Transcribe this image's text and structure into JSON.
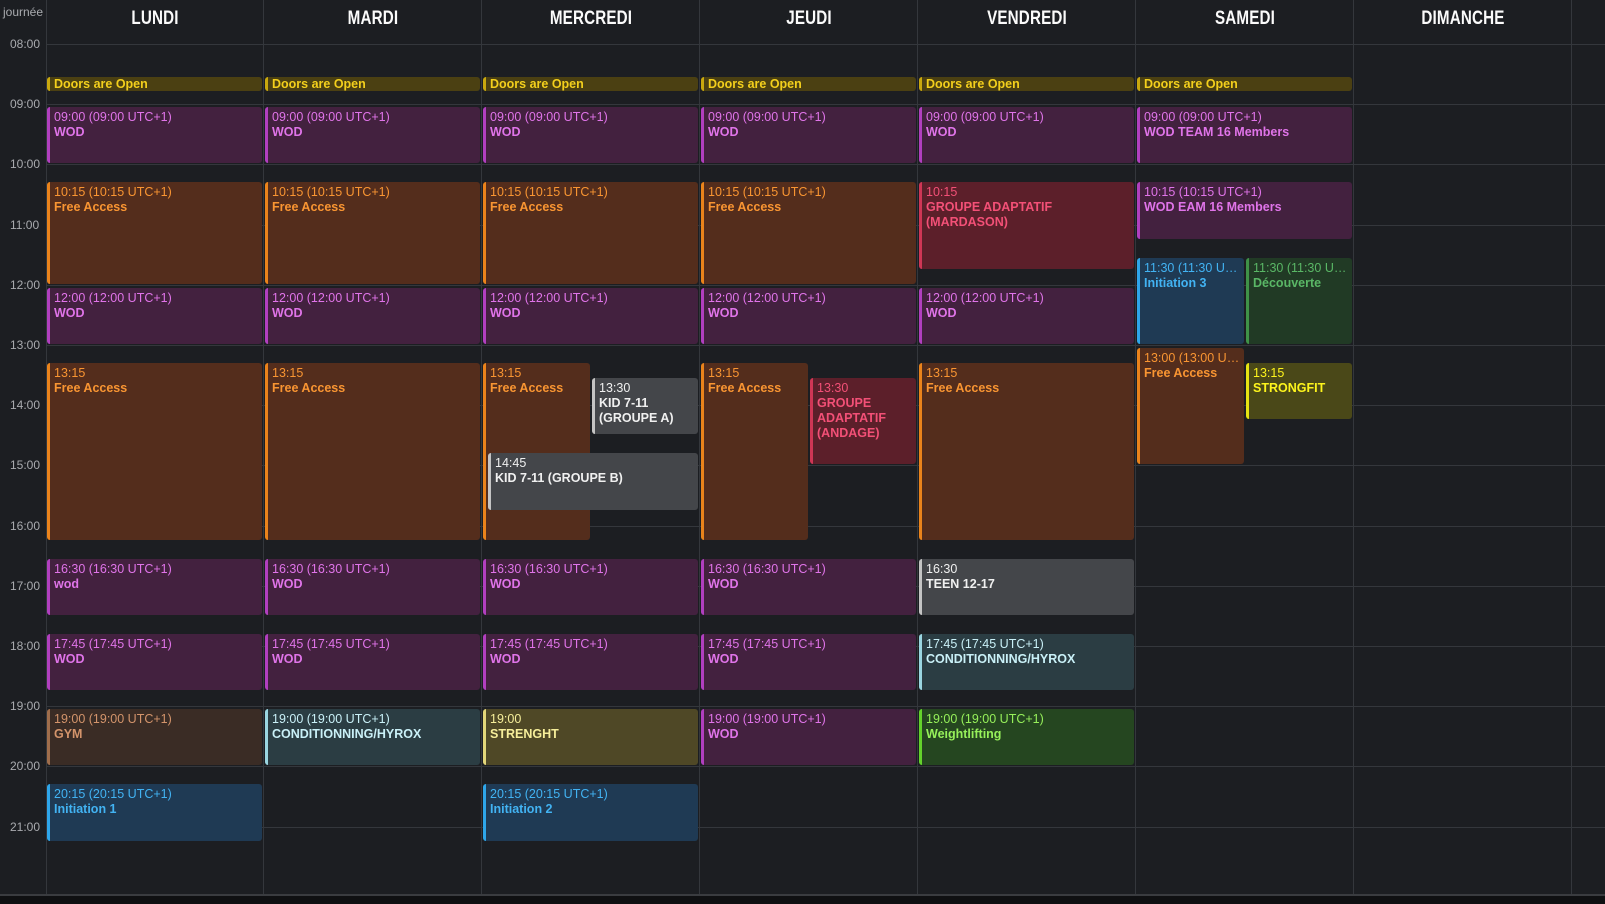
{
  "corner_label": "journée",
  "days": [
    "LUNDI",
    "MARDI",
    "MERCREDI",
    "JEUDI",
    "VENDREDI",
    "SAMEDI",
    "DIMANCHE"
  ],
  "hours": [
    "08:00",
    "09:00",
    "10:00",
    "11:00",
    "12:00",
    "13:00",
    "14:00",
    "15:00",
    "16:00",
    "17:00",
    "18:00",
    "19:00",
    "20:00",
    "21:00"
  ],
  "colors": {
    "background": "#1c1e22",
    "grid": "#34373c",
    "yellow": {
      "bg": "#4b4012",
      "bd": "#c9a80e",
      "fg": "#f3cf1c"
    },
    "purple": {
      "bg": "#43213f",
      "bd": "#b13fbf",
      "fg": "#e074e9"
    },
    "orange": {
      "bg": "#542d1c",
      "bd": "#ea831b",
      "fg": "#f99532"
    },
    "red": {
      "bg": "#5c1f2a",
      "bd": "#cf3655",
      "fg": "#f35077"
    },
    "grey": {
      "bg": "#44464a",
      "bd": "#c4c4c4",
      "fg": "#f0f0f0"
    },
    "teal": {
      "bg": "#2b3d43",
      "bd": "#9ad5e0",
      "fg": "#c9f0f7"
    },
    "brown": {
      "bg": "#3a2c25",
      "bd": "#9f6d4b",
      "fg": "#d3946b"
    },
    "olive": {
      "bg": "#4f4826",
      "bd": "#e3d679",
      "fg": "#f6ee9a"
    },
    "blue": {
      "bg": "#1f3a54",
      "bd": "#2ea6ea",
      "fg": "#42b3f3"
    },
    "green": {
      "bg": "#254620",
      "bd": "#64d22b",
      "fg": "#96f05a"
    },
    "darkgreen": {
      "bg": "#213a25",
      "bd": "#3f9248",
      "fg": "#5ab766"
    },
    "brightyellow": {
      "bg": "#4a4818",
      "bd": "#e6e313",
      "fg": "#fdf41c"
    }
  },
  "events": [
    {
      "day": 0,
      "time": "",
      "name": "Doors are Open",
      "start": 8.55,
      "end": 8.78,
      "color": "yellow",
      "banner": true
    },
    {
      "day": 0,
      "time": "09:00 (09:00 UTC+1)",
      "name": "WOD",
      "start": 9.05,
      "end": 10.0,
      "color": "purple"
    },
    {
      "day": 0,
      "time": "10:15 (10:15 UTC+1)",
      "name": "Free Access",
      "start": 10.3,
      "end": 12.0,
      "color": "orange"
    },
    {
      "day": 0,
      "time": "12:00 (12:00 UTC+1)",
      "name": "WOD",
      "start": 12.05,
      "end": 13.0,
      "color": "purple"
    },
    {
      "day": 0,
      "time": "13:15",
      "name": "Free Access",
      "start": 13.3,
      "end": 16.25,
      "color": "orange"
    },
    {
      "day": 0,
      "time": "16:30 (16:30 UTC+1)",
      "name": "wod",
      "start": 16.55,
      "end": 17.5,
      "color": "purple"
    },
    {
      "day": 0,
      "time": "17:45 (17:45 UTC+1)",
      "name": "WOD",
      "start": 17.8,
      "end": 18.75,
      "color": "purple"
    },
    {
      "day": 0,
      "time": "19:00 (19:00 UTC+1)",
      "name": "GYM",
      "start": 19.05,
      "end": 20.0,
      "color": "brown"
    },
    {
      "day": 0,
      "time": "20:15 (20:15 UTC+1)",
      "name": "Initiation 1",
      "start": 20.3,
      "end": 21.25,
      "color": "blue"
    },
    {
      "day": 1,
      "time": "",
      "name": "Doors are Open",
      "start": 8.55,
      "end": 8.78,
      "color": "yellow",
      "banner": true
    },
    {
      "day": 1,
      "time": "09:00 (09:00 UTC+1)",
      "name": "WOD",
      "start": 9.05,
      "end": 10.0,
      "color": "purple"
    },
    {
      "day": 1,
      "time": "10:15 (10:15 UTC+1)",
      "name": "Free Access",
      "start": 10.3,
      "end": 12.0,
      "color": "orange"
    },
    {
      "day": 1,
      "time": "12:00 (12:00 UTC+1)",
      "name": "WOD",
      "start": 12.05,
      "end": 13.0,
      "color": "purple"
    },
    {
      "day": 1,
      "time": "13:15",
      "name": "Free Access",
      "start": 13.3,
      "end": 16.25,
      "color": "orange"
    },
    {
      "day": 1,
      "time": "16:30 (16:30 UTC+1)",
      "name": "WOD",
      "start": 16.55,
      "end": 17.5,
      "color": "purple"
    },
    {
      "day": 1,
      "time": "17:45 (17:45 UTC+1)",
      "name": "WOD",
      "start": 17.8,
      "end": 18.75,
      "color": "purple"
    },
    {
      "day": 1,
      "time": "19:00 (19:00 UTC+1)",
      "name": "CONDITIONNING/HYROX",
      "start": 19.05,
      "end": 20.0,
      "color": "teal"
    },
    {
      "day": 2,
      "time": "",
      "name": "Doors are Open",
      "start": 8.55,
      "end": 8.78,
      "color": "yellow",
      "banner": true
    },
    {
      "day": 2,
      "time": "09:00 (09:00 UTC+1)",
      "name": "WOD",
      "start": 9.05,
      "end": 10.0,
      "color": "purple"
    },
    {
      "day": 2,
      "time": "10:15 (10:15 UTC+1)",
      "name": "Free Access",
      "start": 10.3,
      "end": 12.0,
      "color": "orange"
    },
    {
      "day": 2,
      "time": "12:00 (12:00 UTC+1)",
      "name": "WOD",
      "start": 12.05,
      "end": 13.0,
      "color": "purple"
    },
    {
      "day": 2,
      "time": "13:15",
      "name": "Free Access",
      "start": 13.3,
      "end": 16.25,
      "color": "orange",
      "col": "left"
    },
    {
      "day": 2,
      "time": "13:30",
      "name": "KID  7-11 (GROUPE A)",
      "start": 13.55,
      "end": 14.5,
      "color": "grey",
      "col": "right"
    },
    {
      "day": 2,
      "time": "14:45",
      "name": "KID 7-11 (GROUPE B)",
      "start": 14.8,
      "end": 15.75,
      "color": "grey",
      "col": "inset"
    },
    {
      "day": 2,
      "time": "16:30 (16:30 UTC+1)",
      "name": "WOD",
      "start": 16.55,
      "end": 17.5,
      "color": "purple"
    },
    {
      "day": 2,
      "time": "17:45 (17:45 UTC+1)",
      "name": "WOD",
      "start": 17.8,
      "end": 18.75,
      "color": "purple"
    },
    {
      "day": 2,
      "time": "19:00",
      "name": "STRENGHT",
      "start": 19.05,
      "end": 20.0,
      "color": "olive"
    },
    {
      "day": 2,
      "time": "20:15 (20:15 UTC+1)",
      "name": "Initiation 2",
      "start": 20.3,
      "end": 21.25,
      "color": "blue"
    },
    {
      "day": 3,
      "time": "",
      "name": "Doors are Open",
      "start": 8.55,
      "end": 8.78,
      "color": "yellow",
      "banner": true
    },
    {
      "day": 3,
      "time": "09:00 (09:00 UTC+1)",
      "name": "WOD",
      "start": 9.05,
      "end": 10.0,
      "color": "purple"
    },
    {
      "day": 3,
      "time": "10:15 (10:15 UTC+1)",
      "name": "Free Access",
      "start": 10.3,
      "end": 12.0,
      "color": "orange"
    },
    {
      "day": 3,
      "time": "12:00 (12:00 UTC+1)",
      "name": "WOD",
      "start": 12.05,
      "end": 13.0,
      "color": "purple"
    },
    {
      "day": 3,
      "time": "13:15",
      "name": "Free Access",
      "start": 13.3,
      "end": 16.25,
      "color": "orange",
      "col": "left"
    },
    {
      "day": 3,
      "time": "13:30",
      "name": "GROUPE ADAPTATIF (ANDAGE)",
      "start": 13.55,
      "end": 15.0,
      "color": "red",
      "col": "right"
    },
    {
      "day": 3,
      "time": "16:30 (16:30 UTC+1)",
      "name": "WOD",
      "start": 16.55,
      "end": 17.5,
      "color": "purple"
    },
    {
      "day": 3,
      "time": "17:45 (17:45 UTC+1)",
      "name": "WOD",
      "start": 17.8,
      "end": 18.75,
      "color": "purple"
    },
    {
      "day": 3,
      "time": "19:00 (19:00 UTC+1)",
      "name": "WOD",
      "start": 19.05,
      "end": 20.0,
      "color": "purple"
    },
    {
      "day": 4,
      "time": "",
      "name": "Doors are Open",
      "start": 8.55,
      "end": 8.78,
      "color": "yellow",
      "banner": true
    },
    {
      "day": 4,
      "time": "09:00 (09:00 UTC+1)",
      "name": "WOD",
      "start": 9.05,
      "end": 10.0,
      "color": "purple"
    },
    {
      "day": 4,
      "time": "10:15",
      "name": "GROUPE ADAPTATIF (MARDASON)",
      "start": 10.3,
      "end": 11.75,
      "color": "red"
    },
    {
      "day": 4,
      "time": "12:00 (12:00 UTC+1)",
      "name": "WOD",
      "start": 12.05,
      "end": 13.0,
      "color": "purple"
    },
    {
      "day": 4,
      "time": "13:15",
      "name": "Free Access",
      "start": 13.3,
      "end": 16.25,
      "color": "orange"
    },
    {
      "day": 4,
      "time": "16:30",
      "name": "TEEN 12-17",
      "start": 16.55,
      "end": 17.5,
      "color": "grey"
    },
    {
      "day": 4,
      "time": "17:45 (17:45 UTC+1)",
      "name": "CONDITIONNING/HYROX",
      "start": 17.8,
      "end": 18.75,
      "color": "teal"
    },
    {
      "day": 4,
      "time": "19:00 (19:00 UTC+1)",
      "name": "Weightlifting",
      "start": 19.05,
      "end": 20.0,
      "color": "green"
    },
    {
      "day": 5,
      "time": "",
      "name": "Doors are Open",
      "start": 8.55,
      "end": 8.78,
      "color": "yellow",
      "banner": true
    },
    {
      "day": 5,
      "time": "09:00 (09:00 UTC+1)",
      "name": "WOD TEAM 16 Members",
      "start": 9.05,
      "end": 10.0,
      "color": "purple"
    },
    {
      "day": 5,
      "time": "10:15 (10:15 UTC+1)",
      "name": "WOD EAM 16 Members",
      "start": 10.3,
      "end": 11.25,
      "color": "purple"
    },
    {
      "day": 5,
      "time": "11:30 (11:30 UT...",
      "name": "Initiation 3",
      "start": 11.55,
      "end": 13.0,
      "color": "blue",
      "col": "left"
    },
    {
      "day": 5,
      "time": "11:30 (11:30 UT...",
      "name": "Découverte",
      "start": 11.55,
      "end": 13.0,
      "color": "darkgreen",
      "col": "right"
    },
    {
      "day": 5,
      "time": "13:00 (13:00 UT...",
      "name": "Free Access",
      "start": 13.05,
      "end": 15.0,
      "color": "orange",
      "col": "left"
    },
    {
      "day": 5,
      "time": "13:15",
      "name": "STRONGFIT",
      "start": 13.3,
      "end": 14.25,
      "color": "brightyellow",
      "col": "right"
    }
  ]
}
